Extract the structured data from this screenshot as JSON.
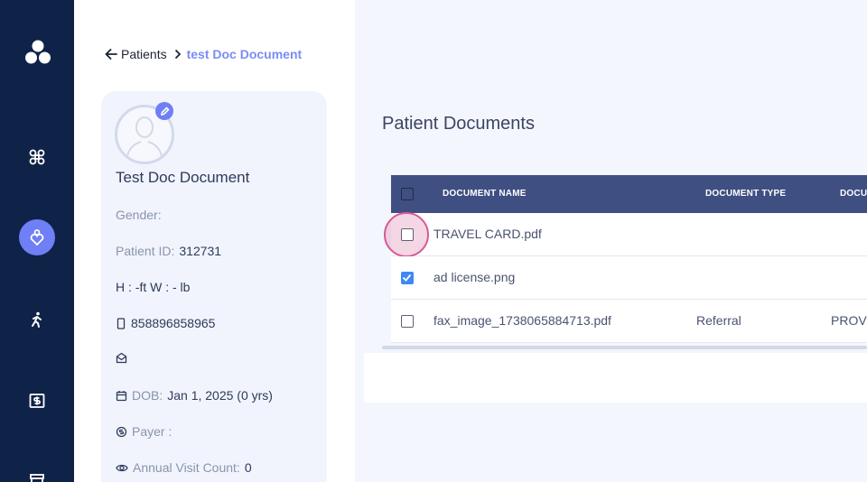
{
  "breadcrumb": {
    "back_label": "Patients",
    "current": "test Doc Document"
  },
  "patient": {
    "name": "Test Doc Document",
    "gender_label": "Gender:",
    "gender_value": "",
    "patient_id_label": "Patient ID:",
    "patient_id_value": "312731",
    "height_weight": "H : -ft W : - lb",
    "phone": "858896858965",
    "email": "",
    "dob_label": "DOB:",
    "dob_value": "Jan 1, 2025 (0 yrs)",
    "payer_label": "Payer :",
    "payer_value": "",
    "visit_count_label": "Annual Visit Count:",
    "visit_count_value": "0"
  },
  "main": {
    "title": "Patient Documents",
    "table": {
      "headers": [
        "DOCUMENT NAME",
        "DOCUMENT TYPE",
        "DOCU"
      ],
      "rows": [
        {
          "name": "TRAVEL CARD.pdf",
          "type": "",
          "third": "",
          "checked": false
        },
        {
          "name": "ad license.png",
          "type": "",
          "third": "",
          "checked": true
        },
        {
          "name": "fax_image_1738065884713.pdf",
          "type": "Referral",
          "third": "PROVI",
          "checked": false
        }
      ]
    }
  },
  "colors": {
    "nav_bg": "#0f2247",
    "accent": "#6f7ff5",
    "table_header": "#3f4f82",
    "checkbox_checked": "#3f87f5",
    "highlight": "#d85a93"
  }
}
